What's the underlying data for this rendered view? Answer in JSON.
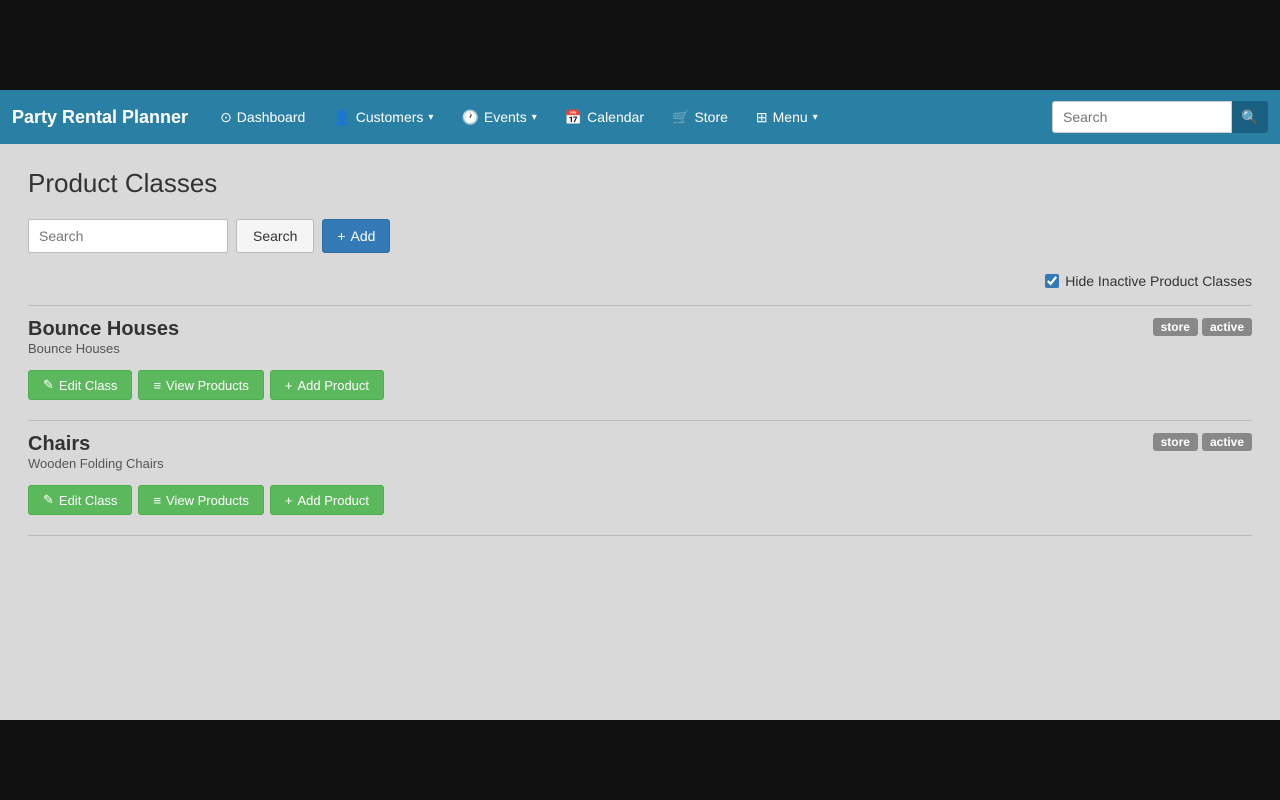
{
  "app": {
    "title": "Party Rental Planner"
  },
  "navbar": {
    "brand": "Party Rental Planner",
    "items": [
      {
        "id": "dashboard",
        "label": "Dashboard",
        "icon": "⊙",
        "hasDropdown": false
      },
      {
        "id": "customers",
        "label": "Customers",
        "icon": "👤",
        "hasDropdown": true
      },
      {
        "id": "events",
        "label": "Events",
        "icon": "🕐",
        "hasDropdown": true
      },
      {
        "id": "calendar",
        "label": "Calendar",
        "icon": "📅",
        "hasDropdown": false
      },
      {
        "id": "store",
        "label": "Store",
        "icon": "🛒",
        "hasDropdown": false
      },
      {
        "id": "menu",
        "label": "Menu",
        "icon": "⊞",
        "hasDropdown": true
      }
    ],
    "search": {
      "placeholder": "Search",
      "button_label": "🔍"
    }
  },
  "page": {
    "title": "Product Classes"
  },
  "search_bar": {
    "placeholder": "Search",
    "search_button": "Search",
    "add_button": "+ Add",
    "plus_symbol": "+"
  },
  "filter": {
    "label": "Hide Inactive Product Classes",
    "checked": true
  },
  "product_classes": [
    {
      "id": "bounce-houses",
      "name": "Bounce Houses",
      "description": "Bounce Houses",
      "badges": [
        "store",
        "active"
      ],
      "buttons": {
        "edit": "✎ Edit Class",
        "view": "≡ View Products",
        "add": "+ Add Product"
      }
    },
    {
      "id": "chairs",
      "name": "Chairs",
      "description": "Wooden Folding Chairs",
      "badges": [
        "store",
        "active"
      ],
      "buttons": {
        "edit": "✎ Edit Class",
        "view": "≡ View Products",
        "add": "+ Add Product"
      }
    }
  ]
}
